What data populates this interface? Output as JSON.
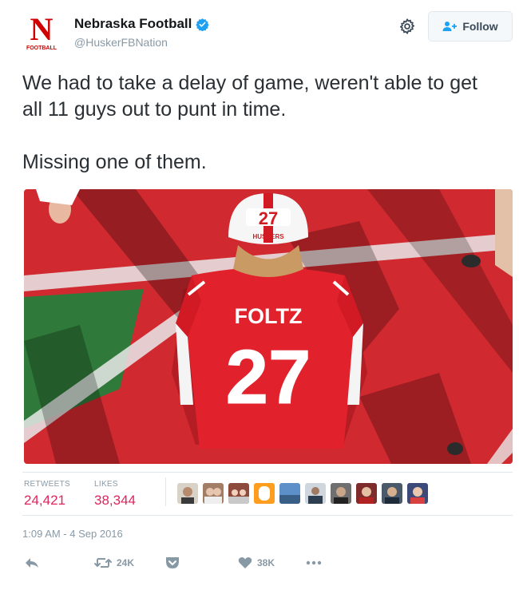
{
  "account": {
    "name": "Nebraska Football",
    "handle": "@HuskerFBNation",
    "logo_letter": "N",
    "logo_caption": "FOOTBALL"
  },
  "follow_button": {
    "label": "Follow"
  },
  "tweet": {
    "line1": "We had to take a delay of game, weren't able to get all 11 guys out to punt in time.",
    "line2": "Missing one of them."
  },
  "photo": {
    "jersey_name": "FOLTZ",
    "jersey_number": "27",
    "helmet_number": "27",
    "helmet_text": "HUSKERS"
  },
  "stats": {
    "retweets_label": "RETWEETS",
    "retweets_value": "24,421",
    "likes_label": "LIKES",
    "likes_value": "38,344"
  },
  "liker_count": 10,
  "timestamp": "1:09 AM - 4 Sep 2016",
  "actions": {
    "retweet_count": "24K",
    "like_count": "38K"
  },
  "colors": {
    "brand_red": "#d00000",
    "verified_blue": "#1da1f2",
    "like_pink": "#e0245e",
    "muted": "#8899a6"
  },
  "icons": [
    "verified-badge-icon",
    "gear-icon",
    "follow-person-icon",
    "reply-icon",
    "retweet-icon",
    "pocket-icon",
    "heart-icon",
    "more-dots-icon"
  ]
}
